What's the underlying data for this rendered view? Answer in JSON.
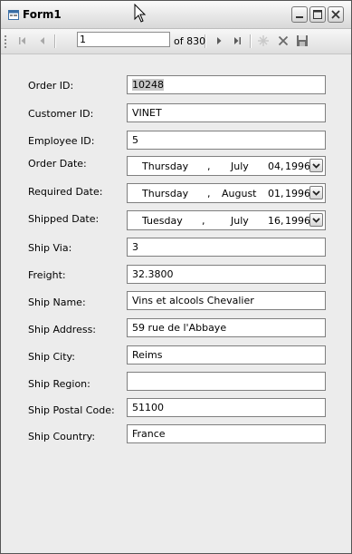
{
  "window": {
    "title": "Form1"
  },
  "navigator": {
    "position": "1",
    "count_label": "of 830"
  },
  "form": {
    "order_id": {
      "label": "Order ID:",
      "value": "10248"
    },
    "customer_id": {
      "label": "Customer ID:",
      "value": "VINET"
    },
    "employee_id": {
      "label": "Employee ID:",
      "value": "5"
    },
    "order_date": {
      "label": "Order Date:",
      "weekday": "Thursday",
      "month": "July",
      "day": "04",
      "year": "1996"
    },
    "required_date": {
      "label": "Required Date:",
      "weekday": "Thursday",
      "month": "August",
      "day": "01",
      "year": "1996"
    },
    "shipped_date": {
      "label": "Shipped Date:",
      "weekday": "Tuesday",
      "month": "July",
      "day": "16",
      "year": "1996"
    },
    "ship_via": {
      "label": "Ship Via:",
      "value": "3"
    },
    "freight": {
      "label": "Freight:",
      "value": "32.3800"
    },
    "ship_name": {
      "label": "Ship Name:",
      "value": "Vins et alcools Chevalier"
    },
    "ship_address": {
      "label": "Ship Address:",
      "value": "59 rue de l'Abbaye"
    },
    "ship_city": {
      "label": "Ship City:",
      "value": "Reims"
    },
    "ship_region": {
      "label": "Ship Region:",
      "value": ""
    },
    "ship_postal_code": {
      "label": "Ship Postal Code:",
      "value": "51100"
    },
    "ship_country": {
      "label": "Ship Country:",
      "value": "France"
    }
  }
}
